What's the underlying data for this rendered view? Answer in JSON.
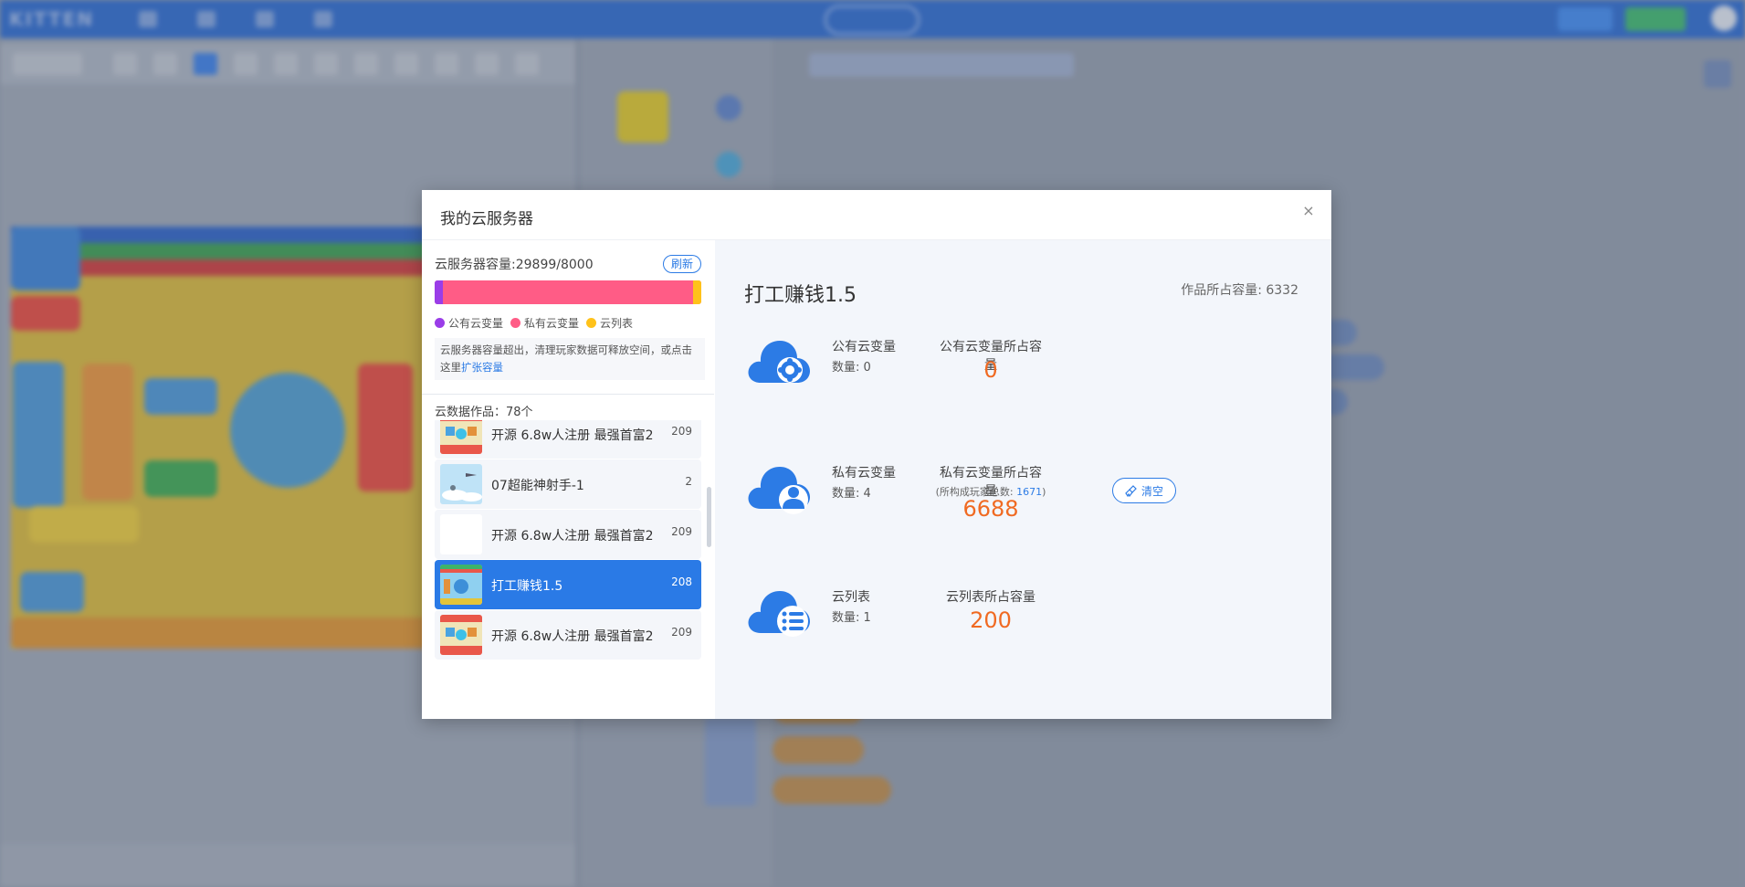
{
  "dialog": {
    "title": "我的云服务器",
    "close_label": "×"
  },
  "capacity": {
    "label": "云服务器容量:29899/8000",
    "refresh_label": "刷新",
    "segments": {
      "public": 0.03,
      "private": 0.94,
      "list": 0.03
    },
    "legend": [
      {
        "label": "公有云变量",
        "color": "#9a3de8"
      },
      {
        "label": "私有云变量",
        "color": "#ff5c86"
      },
      {
        "label": "云列表",
        "color": "#ffc21a"
      }
    ],
    "notice_text": "云服务器容量超出，清理玩家数据可释放空间，或点击这里",
    "notice_link": "扩张容量"
  },
  "works": {
    "count_label": "云数据作品：78个",
    "items": [
      {
        "name": "开源 6.8w人注册 最强首富2",
        "count": "209",
        "thumb": "colorful",
        "selected": false
      },
      {
        "name": "07超能神射手-1",
        "count": "2",
        "thumb": "sky",
        "selected": false
      },
      {
        "name": "开源 6.8w人注册 最强首富2",
        "count": "209",
        "thumb": "blank",
        "selected": false
      },
      {
        "name": "打工赚钱1.5",
        "count": "208",
        "thumb": "worker",
        "selected": true
      },
      {
        "name": "开源 6.8w人注册 最强首富2",
        "count": "209",
        "thumb": "colorful",
        "selected": false
      }
    ]
  },
  "detail": {
    "title": "打工赚钱1.5",
    "size_label": "作品所占容量: 6332",
    "public": {
      "title": "公有云变量",
      "count_label": "数量: 0",
      "cap_title": "公有云变量所占容量",
      "cap_value": "0"
    },
    "private": {
      "title": "私有云变量",
      "count_label": "数量: 4",
      "cap_title": "私有云变量所占容量",
      "cap_sub_prefix": "(所构成玩家总数: ",
      "cap_sub_value": "1671",
      "cap_sub_suffix": ")",
      "cap_value": "6688",
      "clear_label": "清空"
    },
    "list": {
      "title": "云列表",
      "count_label": "数量: 1",
      "cap_title": "云列表所占容量",
      "cap_value": "200"
    }
  },
  "colors": {
    "accent": "#2c7be5",
    "selected": "#2a7ae6",
    "value": "#f06a22"
  }
}
